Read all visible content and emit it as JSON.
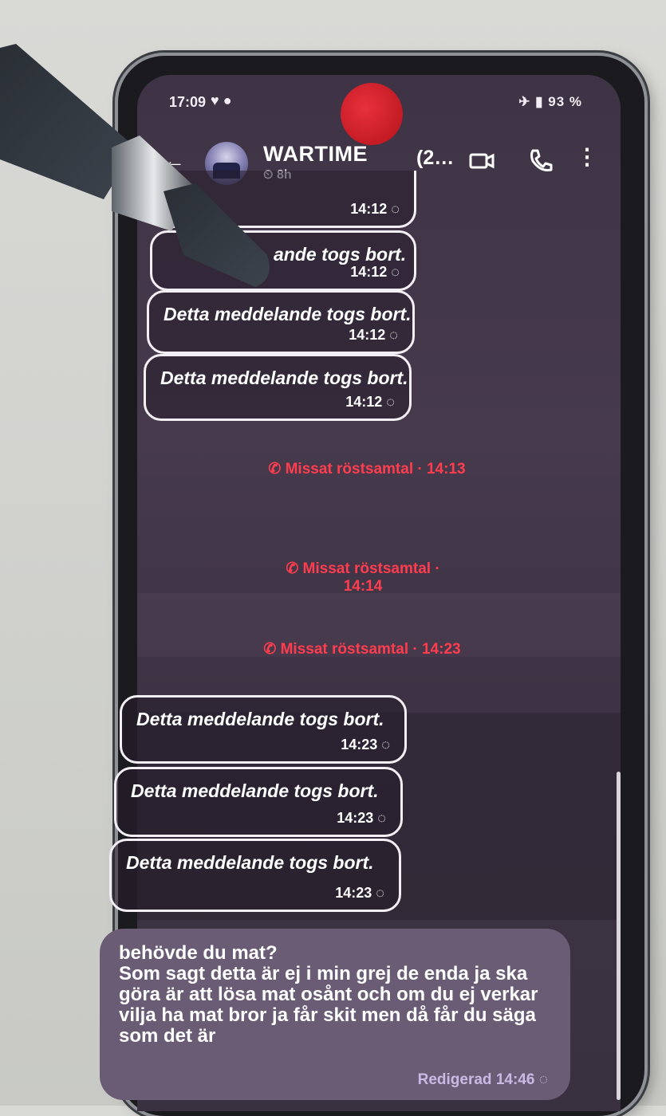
{
  "status": {
    "time": "17:09",
    "battery": "93 %"
  },
  "chat": {
    "name": "WARTIME",
    "timer": "8h",
    "overflow_badge": "(2…"
  },
  "messages": {
    "deleted": [
      {
        "text": "",
        "time": "14:12"
      },
      {
        "text": "ande togs bort.",
        "time": "14:12"
      },
      {
        "text": "Detta meddelande togs bort.",
        "time": "14:12"
      },
      {
        "text": "Detta meddelande togs bort.",
        "time": "14:12"
      },
      {
        "text": "Detta meddelande togs bort.",
        "time": "14:23"
      },
      {
        "text": "Detta meddelande togs bort.",
        "time": "14:23"
      },
      {
        "text": "Detta meddelande togs bort.",
        "time": "14:23"
      }
    ],
    "calls": [
      "Missat röstsamtal · 14:13",
      "Missat röstsamtal ·\n14:14",
      "Missat röstsamtal · 14:23"
    ],
    "last": {
      "text": "behövde du mat?\nSom sagt detta är ej i min grej de enda ja ska göra är att lösa mat osånt och om du ej verkar vilja ha mat bror ja får skit men då får du säga som det är",
      "meta": "Redigerad 14:46"
    }
  },
  "icons": {
    "back": "arrow-left-icon",
    "video": "video-icon",
    "call": "phone-icon",
    "more": "more-vert-icon",
    "timer": "timer-icon",
    "call_missed": "phone-icon",
    "delivered": "check-circle-icon"
  },
  "colors": {
    "accent_missed": "#ff3d4f",
    "bubble_incoming": "#6a5c74",
    "screen_bg": "#40354a"
  }
}
